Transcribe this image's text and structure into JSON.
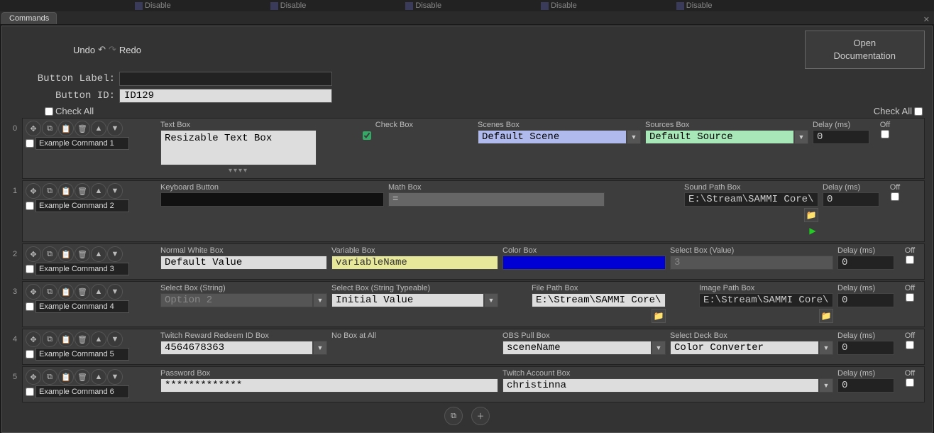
{
  "topbar": {
    "disable": "Disable"
  },
  "tab": {
    "title": "Commands"
  },
  "undo": "Undo",
  "redo": "Redo",
  "openDoc": {
    "line1": "Open",
    "line2": "Documentation"
  },
  "buttonLabel": {
    "label": "Button Label:",
    "value": ""
  },
  "buttonId": {
    "label": "Button ID:",
    "value": "ID129"
  },
  "checkAllLeft": "Check All",
  "checkAllRight": "Check All",
  "labels": {
    "textBox": "Text Box",
    "checkBox": "Check Box",
    "scenesBox": "Scenes Box",
    "sourcesBox": "Sources Box",
    "delay": "Delay (ms)",
    "off": "Off",
    "keyboard": "Keyboard Button",
    "math": "Math Box",
    "soundPath": "Sound Path Box",
    "normalWhite": "Normal White Box",
    "variableBox": "Variable Box",
    "colorBox": "Color Box",
    "selectValue": "Select Box (Value)",
    "selectString": "Select Box (String)",
    "selectStringType": "Select Box (String Typeable)",
    "filePath": "File Path Box",
    "imagePath": "Image Path Box",
    "twitchReward": "Twitch Reward Redeem ID Box",
    "noBox": "No Box at All",
    "obsPull": "OBS Pull Box",
    "selectDeck": "Select Deck Box",
    "password": "Password Box",
    "twitchAccount": "Twitch Account Box"
  },
  "rows": [
    {
      "idx": "0",
      "name": "Example Command 1",
      "textBox": "Resizable Text Box",
      "checkBox": true,
      "scenes": "Default Scene",
      "sources": "Default Source",
      "delay": "0"
    },
    {
      "idx": "1",
      "name": "Example Command 2",
      "keyboard": "",
      "math": "=",
      "soundPath": "E:\\Stream\\SAMMI Core\\p.o",
      "delay": "0"
    },
    {
      "idx": "2",
      "name": "Example Command 3",
      "normalWhite": "Default Value",
      "variable": "variableName",
      "color": "",
      "selectValue": "3",
      "delay": "0"
    },
    {
      "idx": "3",
      "name": "Example Command 4",
      "selectString": "Option 2",
      "selectStringType": "Initial Value",
      "filePath": "E:\\Stream\\SAMMI Core\\",
      "imagePath": "E:\\Stream\\SAMMI Core\\",
      "delay": "0"
    },
    {
      "idx": "4",
      "name": "Example Command 5",
      "twitchReward": "4564678363",
      "obsPull": "sceneName",
      "selectDeck": "Color Converter",
      "delay": "0"
    },
    {
      "idx": "5",
      "name": "Example Command 6",
      "password": "*************",
      "twitchAccount": "christinna",
      "delay": "0"
    }
  ]
}
